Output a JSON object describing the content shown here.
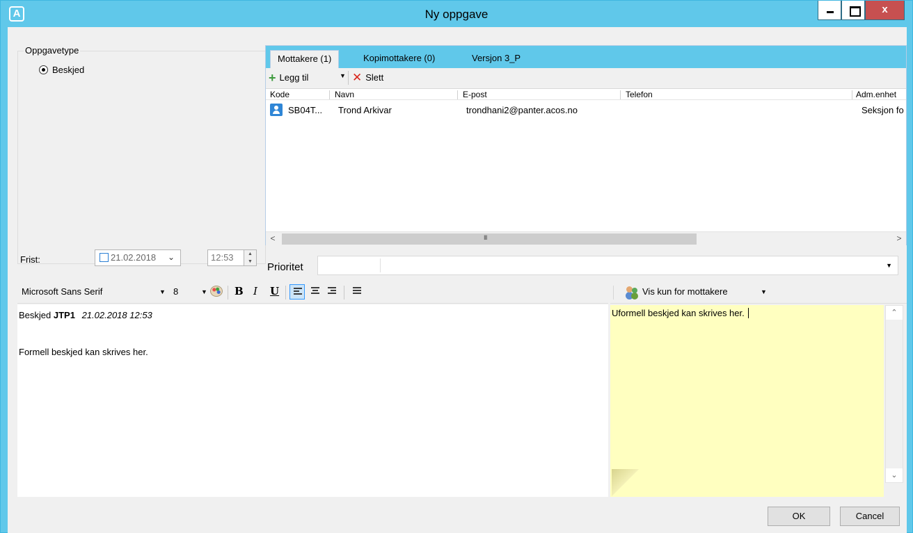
{
  "window": {
    "title": "Ny oppgave",
    "app_icon_letter": "A",
    "close_label": "x"
  },
  "task_type": {
    "group_label": "Oppgavetype",
    "selected_option": "Beskjed"
  },
  "tabs": [
    {
      "label": "Mottakere (1)",
      "active": true
    },
    {
      "label": "Kopimottakere (0)",
      "active": false
    },
    {
      "label": "Versjon 3_P",
      "active": false
    }
  ],
  "toolbar": {
    "add_label": "Legg til",
    "delete_label": "Slett"
  },
  "recipients": {
    "columns": [
      "Kode",
      "Navn",
      "E-post",
      "Telefon",
      "Adm.enhet"
    ],
    "rows": [
      {
        "kode": "SB04T...",
        "navn": "Trond Arkivar",
        "epost": "trondhani2@panter.acos.no",
        "telefon": "",
        "adm_enhet": "Seksjon fo"
      }
    ],
    "scroll_grip": "III"
  },
  "deadline": {
    "label": "Frist:",
    "date": "21.02.2018",
    "time": "12:53",
    "checked": false
  },
  "priority": {
    "label": "Prioritet",
    "value": ""
  },
  "editor_toolbar": {
    "font_name": "Microsoft Sans Serif",
    "font_size": "8",
    "bold": "B",
    "italic": "I",
    "underline": "U"
  },
  "editor": {
    "prefix": "Beskjed",
    "code": "JTP1",
    "timestamp": "21.02.2018 12:53",
    "body": "Formell beskjed kan skrives her."
  },
  "notes": {
    "visibility_label": "Vis kun for mottakere",
    "text": "Uformell beskjed kan skrives her."
  },
  "buttons": {
    "ok": "OK",
    "cancel": "Cancel"
  },
  "colors": {
    "titlebar": "#60c8ea",
    "note_background": "#ffffc0",
    "close_button": "#c75050"
  }
}
